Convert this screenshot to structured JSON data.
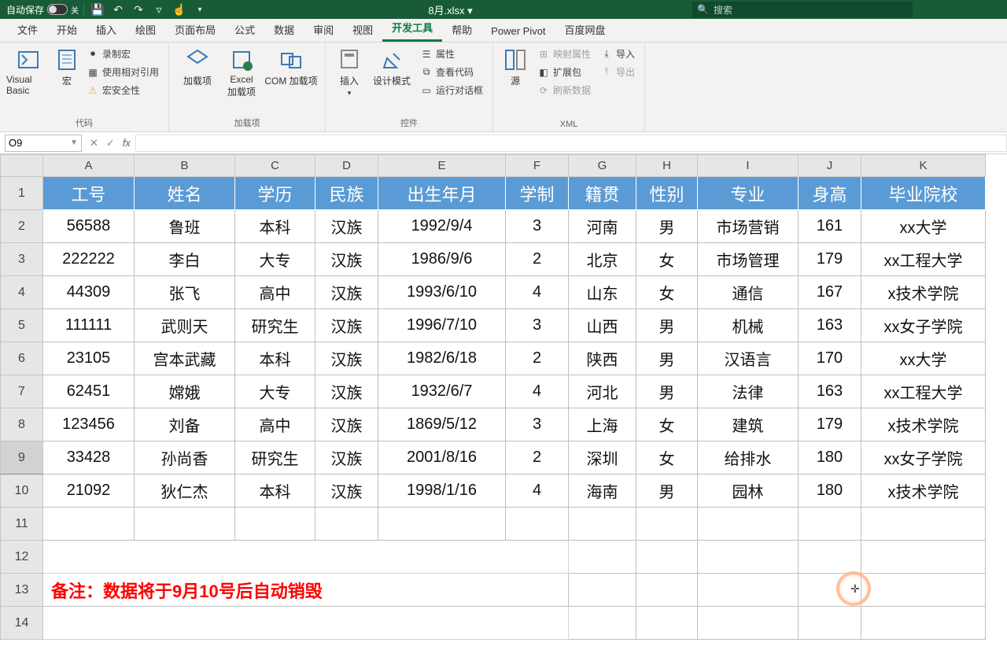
{
  "titlebar": {
    "autosave_label": "自动保存",
    "filename": "8月.xlsx ▾",
    "search_placeholder": "搜索"
  },
  "tabs": [
    "文件",
    "开始",
    "插入",
    "绘图",
    "页面布局",
    "公式",
    "数据",
    "审阅",
    "视图",
    "开发工具",
    "帮助",
    "Power Pivot",
    "百度网盘"
  ],
  "active_tab_index": 9,
  "ribbon": {
    "g1": {
      "label": "代码",
      "vb": "Visual Basic",
      "macro": "宏",
      "rec": "录制宏",
      "rel": "使用相对引用",
      "sec": "宏安全性"
    },
    "g2": {
      "label": "加载项",
      "add": "加载项",
      "excel": "Excel\n加载项",
      "com": "COM 加载项"
    },
    "g3": {
      "label": "控件",
      "ins": "插入",
      "des": "设计模式",
      "prop": "属性",
      "code": "查看代码",
      "dlg": "运行对话框"
    },
    "g4": {
      "label": "XML",
      "src": "源",
      "map": "映射属性",
      "ext": "扩展包",
      "ref": "刷新数据",
      "imp": "导入",
      "exp": "导出"
    }
  },
  "formula": {
    "namebox": "O9"
  },
  "columns": [
    "A",
    "B",
    "C",
    "D",
    "E",
    "F",
    "G",
    "H",
    "I",
    "J",
    "K"
  ],
  "header_row": [
    "工号",
    "姓名",
    "学历",
    "民族",
    "出生年月",
    "学制",
    "籍贯",
    "性别",
    "专业",
    "身高",
    "毕业院校"
  ],
  "rows": [
    [
      "56588",
      "鲁班",
      "本科",
      "汉族",
      "1992/9/4",
      "3",
      "河南",
      "男",
      "市场营销",
      "161",
      "xx大学"
    ],
    [
      "222222",
      "李白",
      "大专",
      "汉族",
      "1986/9/6",
      "2",
      "北京",
      "女",
      "市场管理",
      "179",
      "xx工程大学"
    ],
    [
      "44309",
      "张飞",
      "高中",
      "汉族",
      "1993/6/10",
      "4",
      "山东",
      "女",
      "通信",
      "167",
      "x技术学院"
    ],
    [
      "111111",
      "武则天",
      "研究生",
      "汉族",
      "1996/7/10",
      "3",
      "山西",
      "男",
      "机械",
      "163",
      "xx女子学院"
    ],
    [
      "23105",
      "宫本武藏",
      "本科",
      "汉族",
      "1982/6/18",
      "2",
      "陕西",
      "男",
      "汉语言",
      "170",
      "xx大学"
    ],
    [
      "62451",
      "嫦娥",
      "大专",
      "汉族",
      "1932/6/7",
      "4",
      "河北",
      "男",
      "法律",
      "163",
      "xx工程大学"
    ],
    [
      "123456",
      "刘备",
      "高中",
      "汉族",
      "1869/5/12",
      "3",
      "上海",
      "女",
      "建筑",
      "179",
      "x技术学院"
    ],
    [
      "33428",
      "孙尚香",
      "研究生",
      "汉族",
      "2001/8/16",
      "2",
      "深圳",
      "女",
      "给排水",
      "180",
      "xx女子学院"
    ],
    [
      "21092",
      "狄仁杰",
      "本科",
      "汉族",
      "1998/1/16",
      "4",
      "海南",
      "男",
      "园林",
      "180",
      "x技术学院"
    ]
  ],
  "note": "备注：数据将于9月10号后自动销毁"
}
